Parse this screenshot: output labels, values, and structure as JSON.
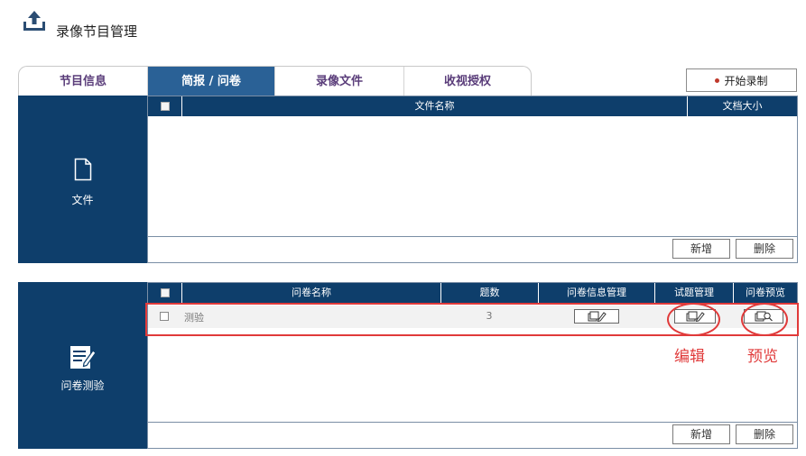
{
  "page": {
    "title": "录像节目管理",
    "header_icon": "upload-icon"
  },
  "tabs": [
    {
      "label": "节目信息",
      "active": false
    },
    {
      "label": "简报 / 问卷",
      "active": true
    },
    {
      "label": "录像文件",
      "active": false
    },
    {
      "label": "收视授权",
      "active": false
    }
  ],
  "record_button": {
    "label": "开始录制",
    "icon": "record-dot-icon",
    "color": "#c0392b"
  },
  "file_section": {
    "side_label": "文件",
    "side_icon": "document-icon",
    "columns": [
      "文件名称",
      "文档大小"
    ],
    "rows": [],
    "add_label": "新增",
    "delete_label": "删除"
  },
  "quiz_section": {
    "side_label": "问卷测验",
    "side_icon": "edit-document-icon",
    "columns": [
      "问卷名称",
      "题数",
      "问卷信息管理",
      "试题管理",
      "问卷预览"
    ],
    "rows": [
      {
        "name": "测验",
        "count": "3",
        "info_icon": "edit-icon",
        "manage_icon": "edit-icon",
        "preview_icon": "preview-icon"
      }
    ],
    "add_label": "新增",
    "delete_label": "删除"
  },
  "annotations": {
    "edit_note": "编辑",
    "preview_note": "预览",
    "color": "#e03a3a"
  },
  "colors": {
    "navy": "#0e3e6b",
    "active_tab": "#2a6196",
    "tab_text": "#5a3d7a"
  }
}
